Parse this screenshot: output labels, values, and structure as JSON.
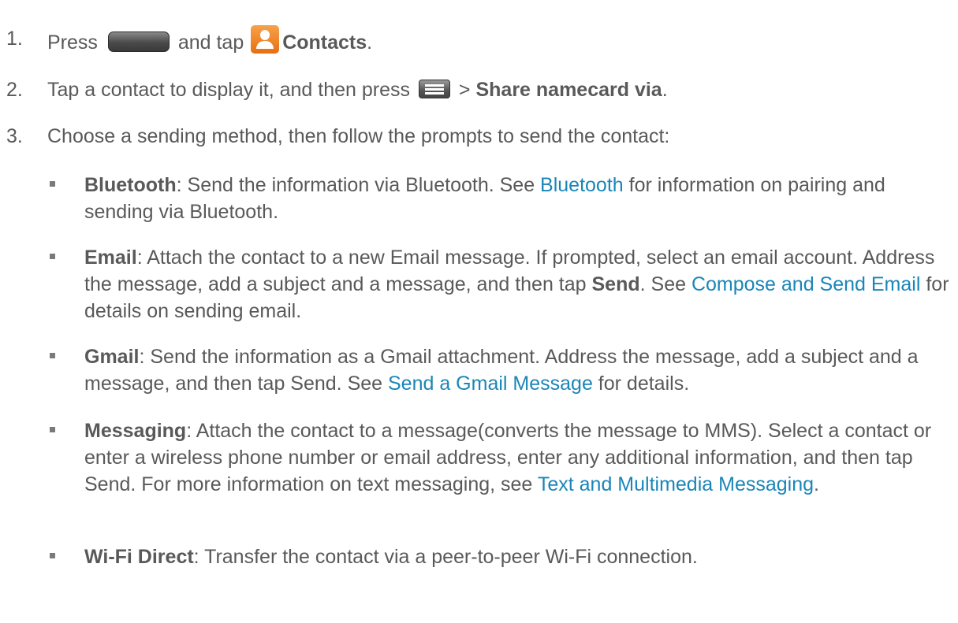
{
  "steps": [
    {
      "num": "1.",
      "text_a": "Press",
      "text_b": "and tap",
      "bold": "Contacts",
      "end": ".",
      "icons": [
        "home-key-icon",
        "contacts-app-icon"
      ]
    },
    {
      "num": "2.",
      "text_a": "Tap a contact to display it, and then press",
      "sep": ">",
      "bold": "Share namecard via",
      "end": ".",
      "icons": [
        "menu-key-icon"
      ]
    },
    {
      "num": "3.",
      "text": "Choose a sending method, then follow the prompts to send the contact:"
    }
  ],
  "bullets": [
    {
      "title": "Bluetooth",
      "t1": ": Send the information via Bluetooth. See ",
      "link1": "Bluetooth",
      "t2": " for information on pairing and sending via Bluetooth."
    },
    {
      "title": "Email",
      "t1": ": Attach the contact to a new Email message. If prompted, select an email account. Address the message, add a subject and a message, and then tap ",
      "bold2": "Send",
      "t2": ". See ",
      "link1": "Compose and Send Email",
      "t3": " for details on sending email."
    },
    {
      "title": "Gmail",
      "t1": ": Send the information as a Gmail attachment. Address the message, add a subject and a message, and then tap Send. See ",
      "link1": "Send a Gmail Message",
      "t2": " for details."
    },
    {
      "title": "Messaging",
      "t1": ": Attach the contact to a message(converts the message to MMS). Select a contact or enter a wireless phone number or email address, enter any additional information, and then tap Send. For more information on text messaging, see ",
      "link1": "Text and Multimedia Messaging",
      "t2": "."
    },
    {
      "title": "Wi-Fi Direct",
      "t1": ": Transfer the contact via a peer-to-peer Wi-Fi connection."
    }
  ],
  "colors": {
    "text": "#595959",
    "link": "#1a86b8",
    "contacts_icon": "#e86f12"
  }
}
